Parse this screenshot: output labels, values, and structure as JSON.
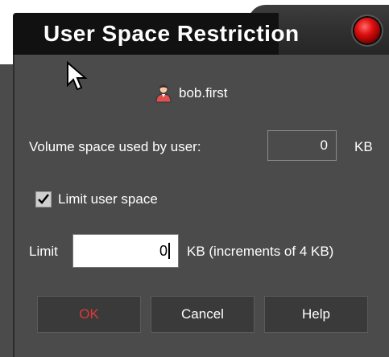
{
  "window": {
    "title": "User Space Restriction",
    "close_icon": "close-button-red-orb-icon"
  },
  "user": {
    "icon": "user-icon",
    "name": "bob.first"
  },
  "volume": {
    "label": "Volume space used by user:",
    "value": "0",
    "unit": "KB"
  },
  "limit_checkbox": {
    "label": "Limit user space",
    "checked": true
  },
  "limit": {
    "label": "Limit",
    "value": "0",
    "unit_note": "KB (increments of 4 KB)"
  },
  "buttons": {
    "ok": "OK",
    "cancel": "Cancel",
    "help": "Help"
  },
  "colors": {
    "background": "#4b4b4b",
    "title_bar": "#111111",
    "ok_text": "#e03838",
    "close_orb": "#e01010"
  }
}
